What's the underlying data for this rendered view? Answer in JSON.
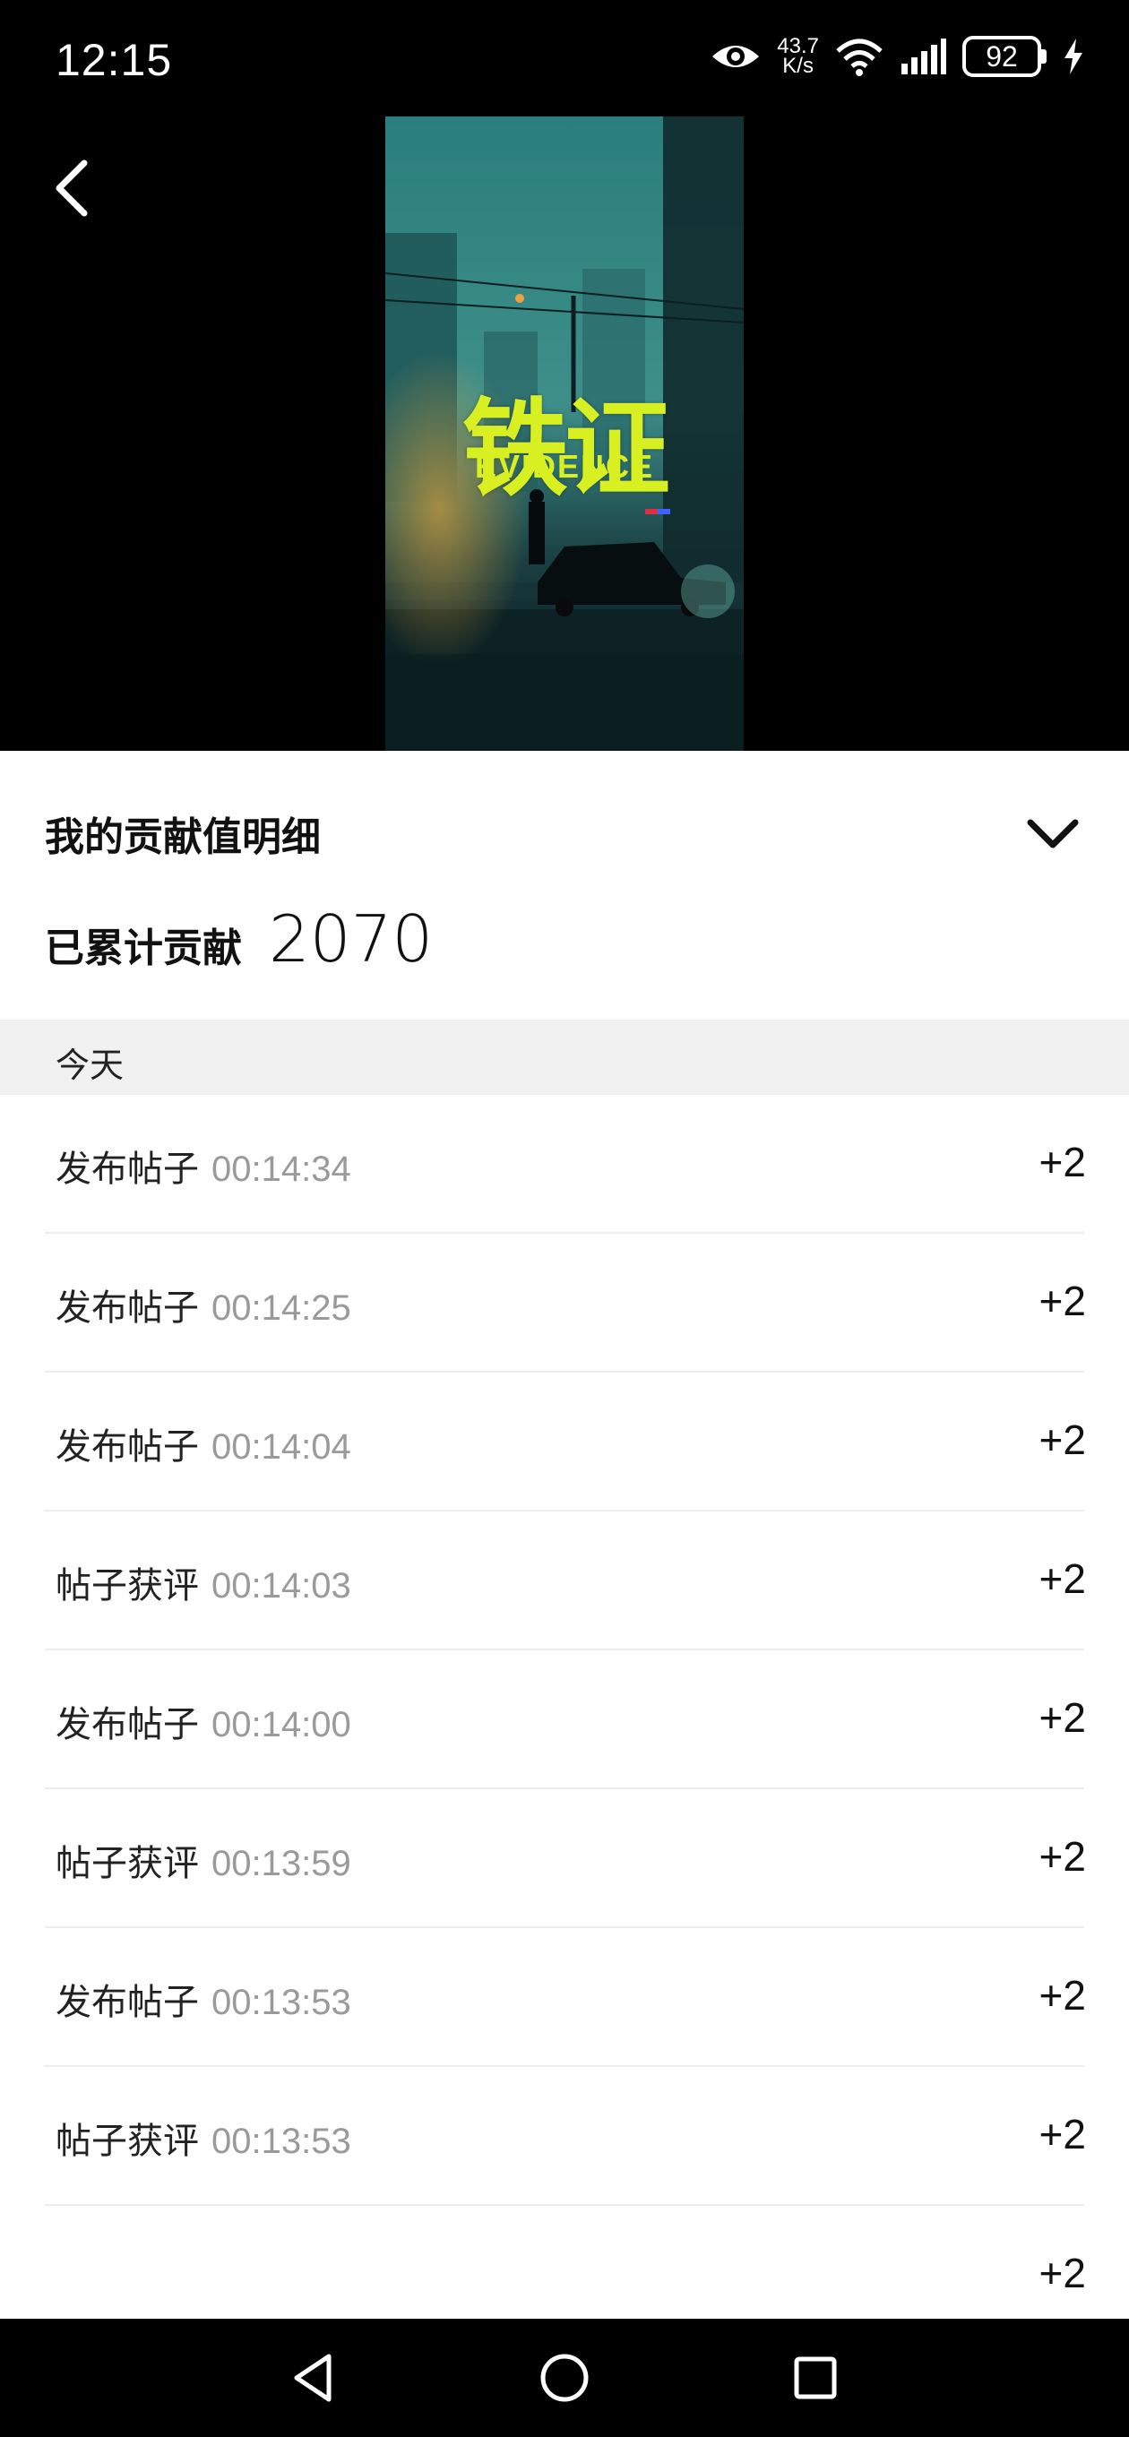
{
  "status_bar": {
    "time": "12:15",
    "net_speed_value": "43.7",
    "net_speed_unit": "K/s",
    "battery": "92",
    "icons": [
      "eye-icon",
      "wifi-icon",
      "signal-icon",
      "battery-icon",
      "charging-icon"
    ]
  },
  "poster": {
    "title": "铁证",
    "subtitle": "EVIDENCE",
    "colors": {
      "title": "#d8f021",
      "sky": "#2f8a86",
      "dark": "#0d1f22"
    }
  },
  "sheet": {
    "title": "我的贡献值明细",
    "total_label": "已累计贡献",
    "total_value": "2070",
    "day_label": "今天",
    "records": [
      {
        "action": "发布帖子",
        "time": "00:14:34",
        "points": "+2"
      },
      {
        "action": "发布帖子",
        "time": "00:14:25",
        "points": "+2"
      },
      {
        "action": "发布帖子",
        "time": "00:14:04",
        "points": "+2"
      },
      {
        "action": "帖子获评",
        "time": "00:14:03",
        "points": "+2"
      },
      {
        "action": "发布帖子",
        "time": "00:14:00",
        "points": "+2"
      },
      {
        "action": "帖子获评",
        "time": "00:13:59",
        "points": "+2"
      },
      {
        "action": "发布帖子",
        "time": "00:13:53",
        "points": "+2"
      },
      {
        "action": "帖子获评",
        "time": "00:13:53",
        "points": "+2"
      },
      {
        "action": "",
        "time": "",
        "points": "+2"
      }
    ]
  },
  "nav": {
    "icons": [
      "back-triangle-icon",
      "home-circle-icon",
      "recents-square-icon"
    ]
  }
}
